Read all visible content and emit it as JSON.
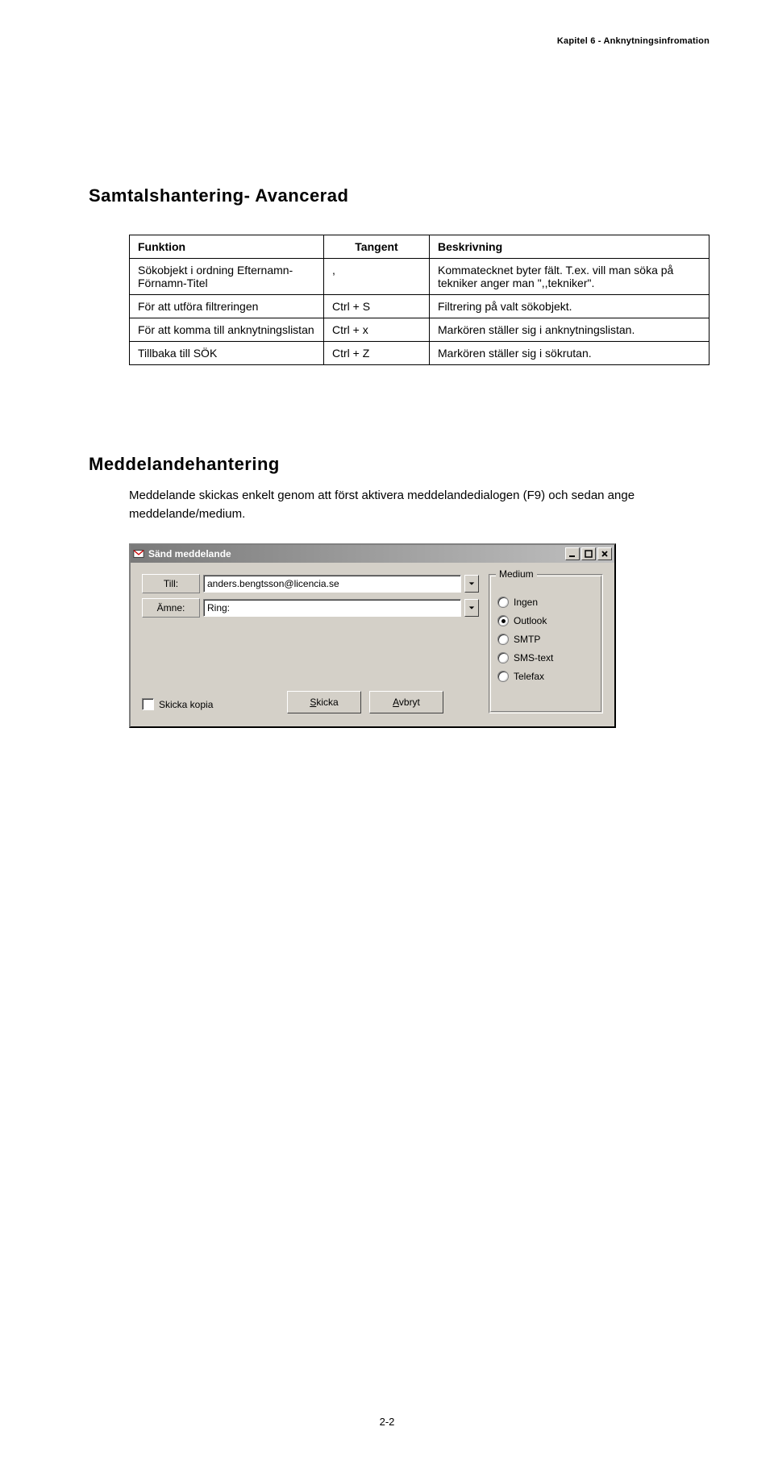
{
  "header": "Kapitel 6 - Anknytningsinfromation",
  "section_title": "Samtalshantering- Avancerad",
  "table": {
    "headers": [
      "Funktion",
      "Tangent",
      "Beskrivning"
    ],
    "rows": [
      {
        "funktion": "Sökobjekt i ordning Efternamn-Förnamn-Titel",
        "tangent": ",",
        "beskrivning": "Kommatecknet byter fält. T.ex. vill man söka på tekniker anger man \",,tekniker\"."
      },
      {
        "funktion": "För att utföra filtreringen",
        "tangent": "Ctrl + S",
        "beskrivning": "Filtrering på valt sökobjekt."
      },
      {
        "funktion": "För att komma till anknytningslistan",
        "tangent": "Ctrl + x",
        "beskrivning": "Markören ställer sig i anknytningslistan."
      },
      {
        "funktion": "Tillbaka till SÖK",
        "tangent": "Ctrl + Z",
        "beskrivning": "Markören ställer sig i sökrutan."
      }
    ]
  },
  "subsection_title": "Meddelandehantering",
  "subsection_body": "Meddelande skickas enkelt genom att först aktivera meddelandedialogen (F9) och sedan ange meddelande/medium.",
  "dialog": {
    "title": "Sänd meddelande",
    "till_label": "Till:",
    "till_value": "anders.bengtsson@licencia.se",
    "amne_label": "Ämne:",
    "amne_value": "Ring:",
    "checkbox_label": "Skicka kopia",
    "send_button": "Skicka",
    "cancel_button": "Avbryt",
    "group_label": "Medium",
    "radios": [
      {
        "label": "Ingen",
        "selected": false
      },
      {
        "label": "Outlook",
        "selected": true
      },
      {
        "label": "SMTP",
        "selected": false
      },
      {
        "label": "SMS-text",
        "selected": false
      },
      {
        "label": "Telefax",
        "selected": false
      }
    ]
  },
  "page_number": "2-2"
}
